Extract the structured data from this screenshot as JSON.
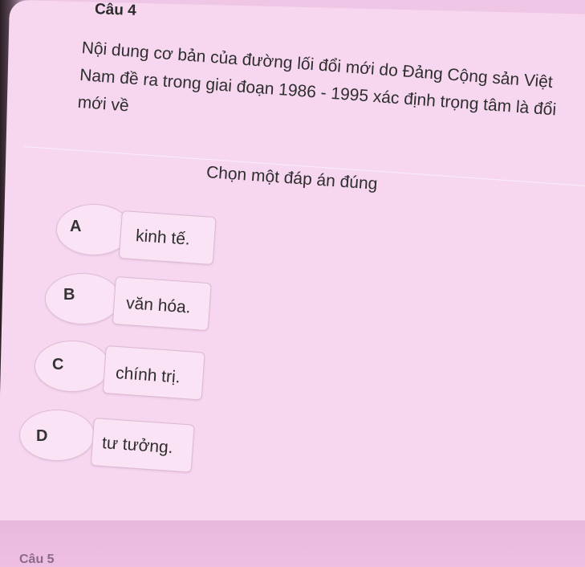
{
  "question": {
    "number": "Câu 4",
    "text": "Nội dung cơ bản của đường lối đổi mới do Đảng Cộng sản Việt Nam đề ra trong giai đoạn 1986 - 1995 xác định trọng tâm là đổi mới về",
    "prompt": "Chọn một đáp án đúng"
  },
  "options": [
    {
      "letter": "A",
      "text": "kinh tế."
    },
    {
      "letter": "B",
      "text": "văn hóa."
    },
    {
      "letter": "C",
      "text": "chính trị."
    },
    {
      "letter": "D",
      "text": "tư tưởng."
    }
  ],
  "next_question": {
    "label": "Câu 5"
  }
}
